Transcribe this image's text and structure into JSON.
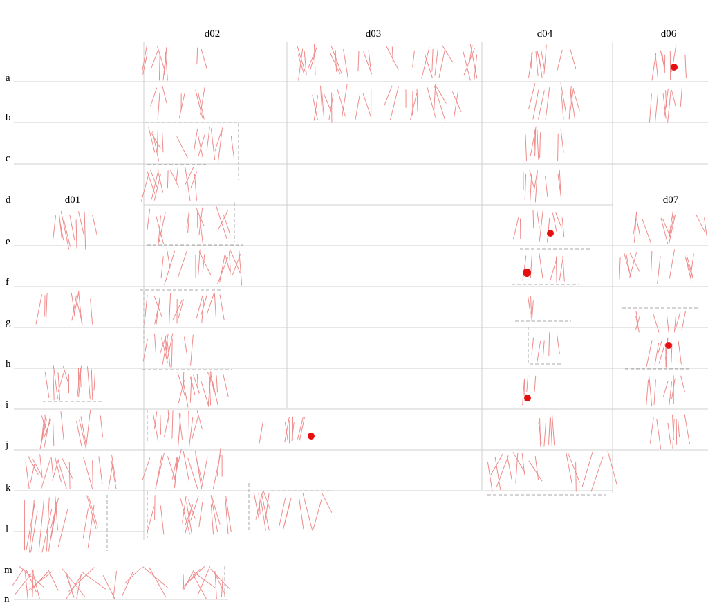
{
  "column_labels": [
    "d01",
    "d02",
    "d03",
    "d04",
    "d06",
    "d07"
  ],
  "row_labels": [
    "a",
    "b",
    "c",
    "d",
    "e",
    "f",
    "g",
    "h",
    "i",
    "j",
    "k",
    "l",
    "m",
    "n"
  ],
  "colors": {
    "strokes": "#ef8a8a",
    "markers": "#e50f0f",
    "grid": "#cfcfcf",
    "dashed_boxes": "#a8a8a8"
  }
}
